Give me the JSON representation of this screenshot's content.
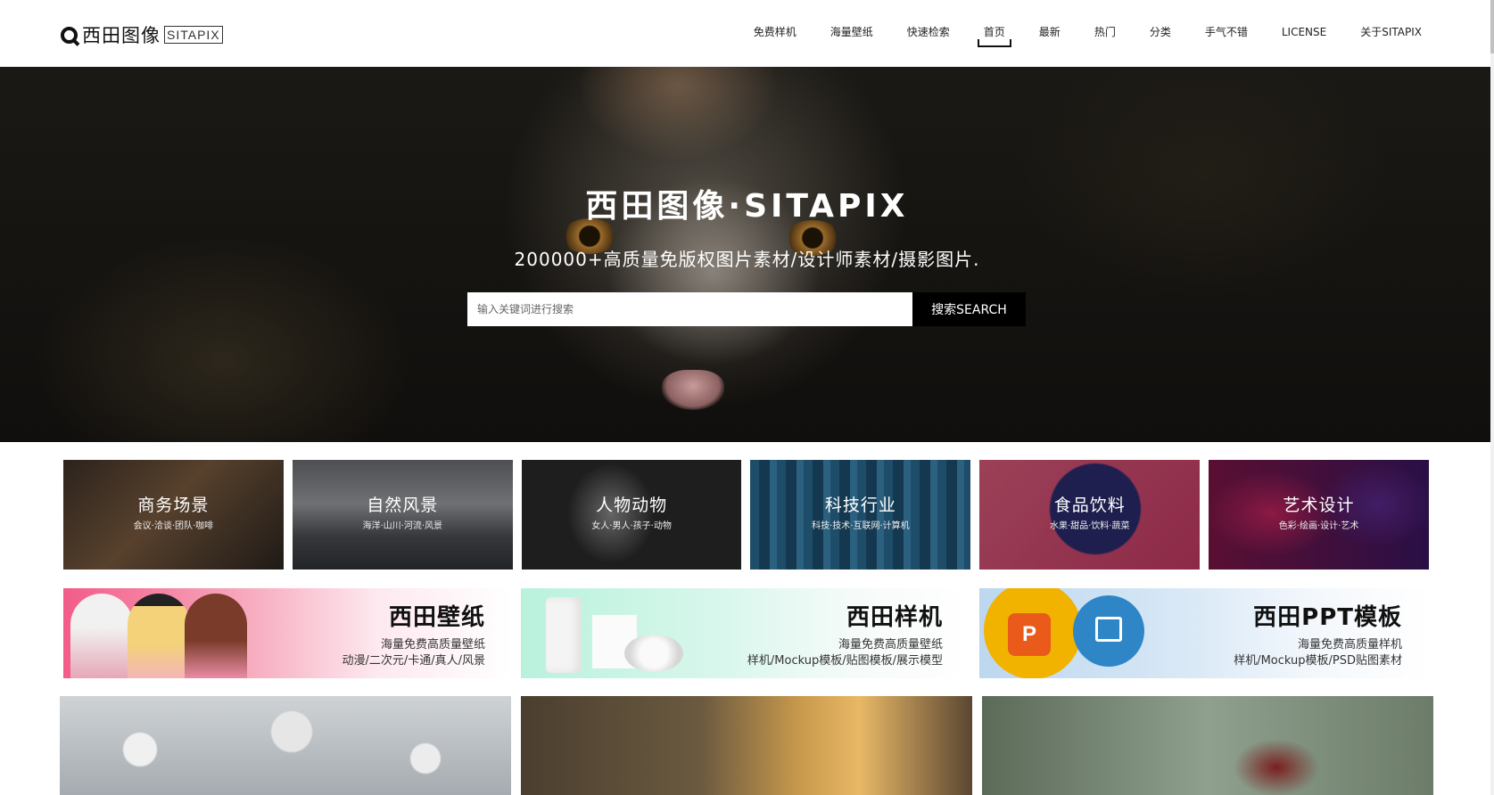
{
  "header": {
    "logo_cn": "西田图像",
    "logo_en": "SITAPIX",
    "nav": [
      {
        "label": "免费样机",
        "active": false
      },
      {
        "label": "海量壁纸",
        "active": false
      },
      {
        "label": "快速检索",
        "active": false
      },
      {
        "label": "首页",
        "active": true
      },
      {
        "label": "最新",
        "active": false
      },
      {
        "label": "热门",
        "active": false
      },
      {
        "label": "分类",
        "active": false
      },
      {
        "label": "手气不错",
        "active": false
      },
      {
        "label": "LICENSE",
        "active": false
      },
      {
        "label": "关于SITAPIX",
        "active": false
      }
    ]
  },
  "hero": {
    "title": "西田图像·SITAPIX",
    "subtitle": "200000+高质量免版权图片素材/设计师素材/摄影图片.",
    "search_placeholder": "输入关键词进行搜索",
    "search_value": "",
    "search_button": "搜索SEARCH"
  },
  "categories": [
    {
      "title": "商务场景",
      "tags": "会议·洽谈·团队·咖啡"
    },
    {
      "title": "自然风景",
      "tags": "海洋·山川·河流·风景"
    },
    {
      "title": "人物动物",
      "tags": "女人·男人·孩子·动物"
    },
    {
      "title": "科技行业",
      "tags": "科技·技术·互联网·计算机"
    },
    {
      "title": "食品饮料",
      "tags": "水果·甜品·饮料·蔬菜"
    },
    {
      "title": "艺术设计",
      "tags": "色彩·绘画·设计·艺术"
    }
  ],
  "banners": [
    {
      "title": "西田壁纸",
      "line1": "海量免费高质量壁纸",
      "line2": "动漫/二次元/卡通/真人/风景"
    },
    {
      "title": "西田样机",
      "line1": "海量免费高质量壁纸",
      "line2": "样机/Mockup模板/贴图模板/展示模型"
    },
    {
      "title": "西田PPT模板",
      "line1": "海量免费高质量样机",
      "line2": "样机/Mockup模板/PSD贴图素材",
      "icon_text": "P"
    }
  ],
  "colors": {
    "accent": "#000000",
    "nav_text": "#222222",
    "hero_text": "#ffffff"
  }
}
